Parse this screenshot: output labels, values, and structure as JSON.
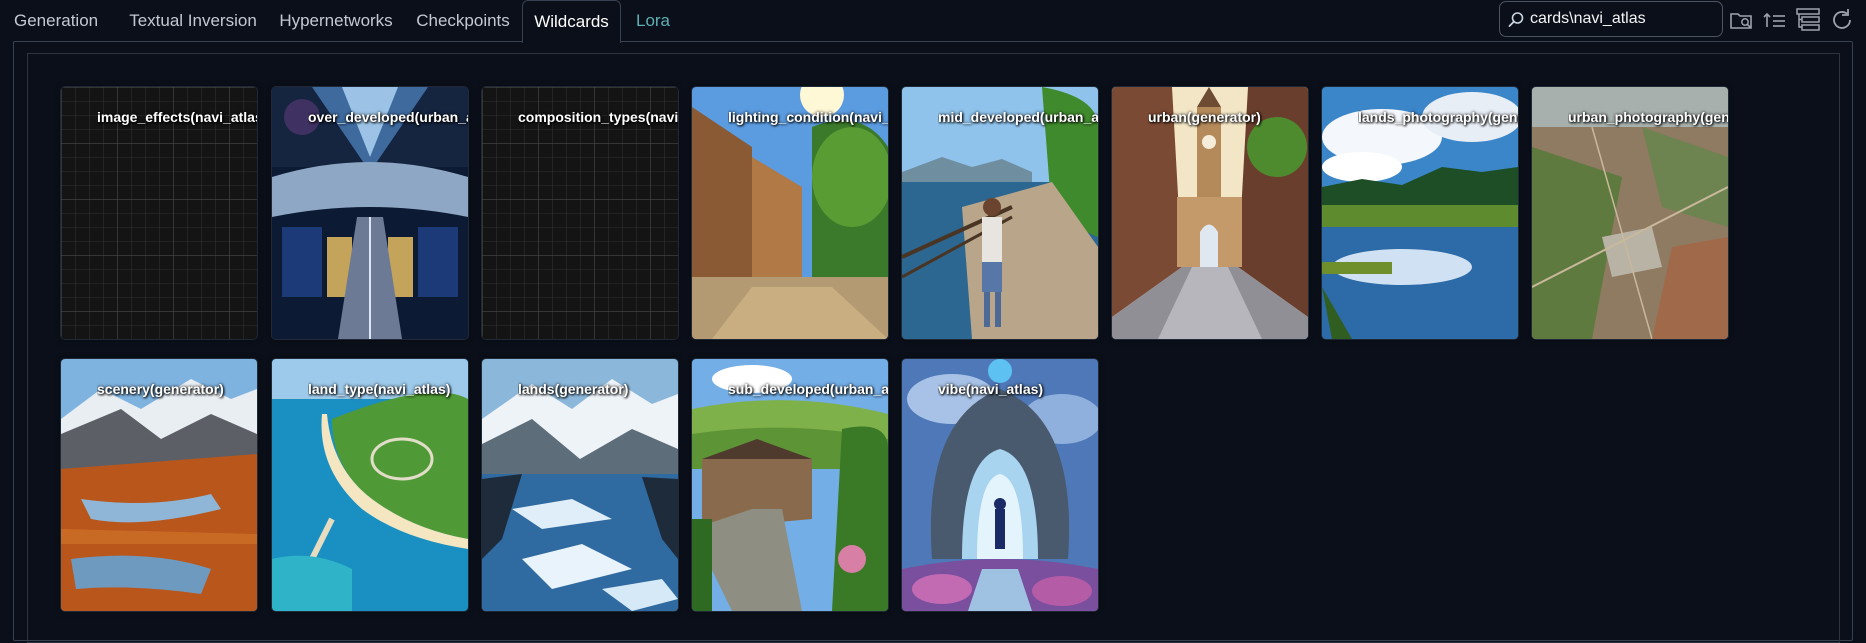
{
  "tabs": [
    {
      "label": "Generation"
    },
    {
      "label": "Textual Inversion"
    },
    {
      "label": "Hypernetworks"
    },
    {
      "label": "Checkpoints"
    },
    {
      "label": "Wildcards"
    },
    {
      "label": "Lora"
    }
  ],
  "active_tab": "Wildcards",
  "search": {
    "value": "cards\\navi_atlas",
    "icon": "search-icon"
  },
  "toolbar_icons": [
    "folder-search-icon",
    "sort-icon",
    "tree-view-icon",
    "refresh-icon"
  ],
  "cards": [
    {
      "label": "image_effects(navi_atlas)",
      "thumb": "grid-placeholder"
    },
    {
      "label": "over_developed(urban_are",
      "thumb": "spaceship-interior"
    },
    {
      "label": "composition_types(navi_a",
      "thumb": "grid-placeholder"
    },
    {
      "label": "lighting_condition(navi_at",
      "thumb": "sunny-street"
    },
    {
      "label": "mid_developed(urban_are",
      "thumb": "boardwalk-woman"
    },
    {
      "label": "urban(generator)",
      "thumb": "clocktower-street"
    },
    {
      "label": "lands_photography(genera",
      "thumb": "lake-reflection"
    },
    {
      "label": "urban_photography(gener",
      "thumb": "aerial-city"
    },
    {
      "label": "scenery(generator)",
      "thumb": "mountain-tundra"
    },
    {
      "label": "land_type(navi_atlas)",
      "thumb": "island-coast"
    },
    {
      "label": "lands(generator)",
      "thumb": "glacier-lake"
    },
    {
      "label": "sub_developed(urban_are",
      "thumb": "village-road"
    },
    {
      "label": "vibe(navi_atlas)",
      "thumb": "fantasy-portal"
    }
  ],
  "colors": {
    "background": "#0b0f19",
    "border": "#374151",
    "active_tab_text": "#ffffff",
    "lora_tab_text": "#5eb0b4"
  }
}
